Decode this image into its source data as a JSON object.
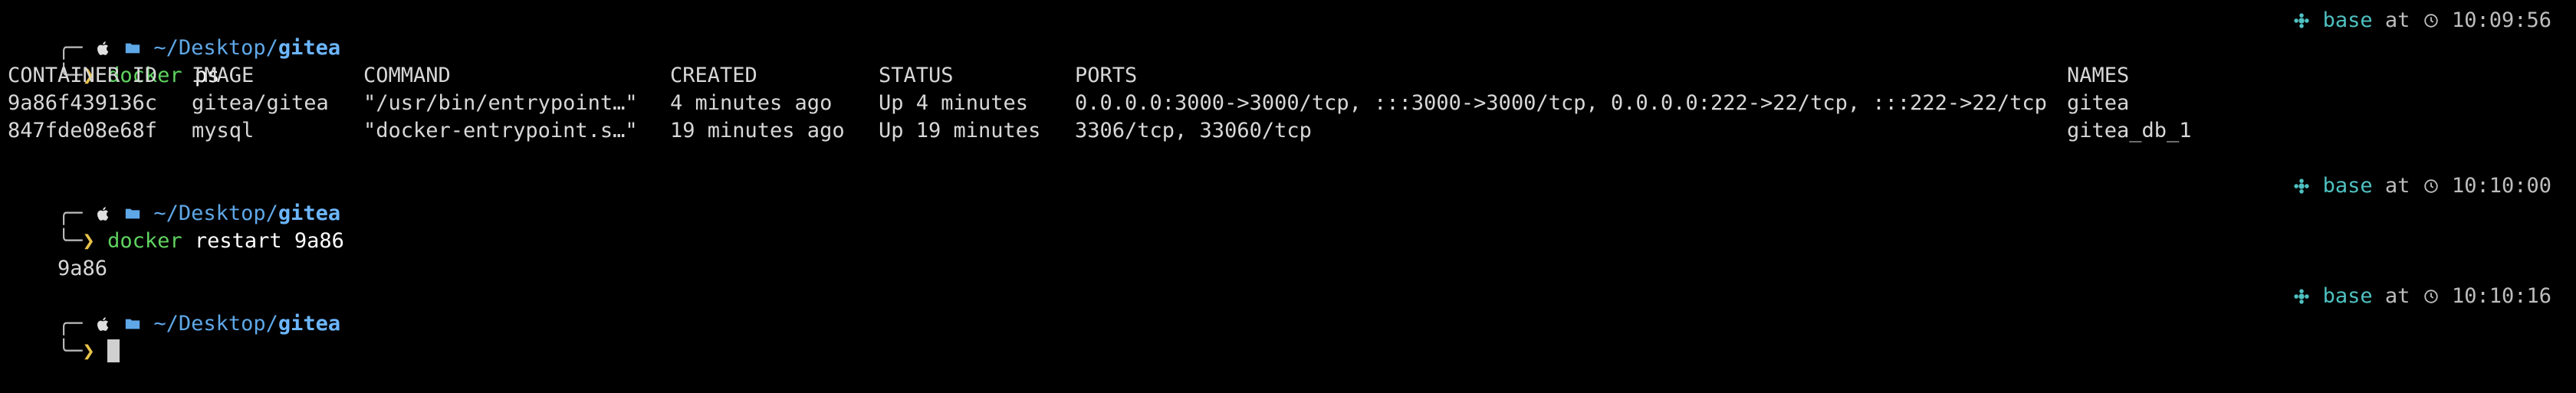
{
  "prompts": [
    {
      "path_prefix": "~/Desktop/",
      "path_dir": "gitea",
      "command": "docker",
      "args": "ps",
      "env": "base",
      "at": "at",
      "time": "10:09:56"
    },
    {
      "path_prefix": "~/Desktop/",
      "path_dir": "gitea",
      "command": "docker",
      "args": "restart 9a86",
      "env": "base",
      "at": "at",
      "time": "10:10:00"
    },
    {
      "path_prefix": "~/Desktop/",
      "path_dir": "gitea",
      "command": "",
      "args": "",
      "env": "base",
      "at": "at",
      "time": "10:10:16"
    }
  ],
  "ps_table": {
    "headers": [
      "CONTAINER ID",
      "IMAGE",
      "COMMAND",
      "CREATED",
      "STATUS",
      "PORTS",
      "NAMES"
    ],
    "rows": [
      [
        "9a86f439136c",
        "gitea/gitea",
        "\"/usr/bin/entrypoint…\"",
        "4 minutes ago",
        "Up 4 minutes",
        "0.0.0.0:3000->3000/tcp, :::3000->3000/tcp, 0.0.0.0:222->22/tcp, :::222->22/tcp",
        "gitea"
      ],
      [
        "847fde08e68f",
        "mysql",
        "\"docker-entrypoint.s…\"",
        "19 minutes ago",
        "Up 19 minutes",
        "3306/tcp, 33060/tcp",
        "gitea_db_1"
      ]
    ]
  },
  "restart_output": "9a86",
  "colors": {
    "background": "#000000",
    "path": "#5fa8e8",
    "command": "#5fd35f",
    "prompt_arrow": "#e8c34a",
    "env_icon": "#4fc1c1"
  },
  "icons": [
    "apple-icon",
    "folder-icon",
    "conda-env-icon",
    "clock-icon"
  ]
}
